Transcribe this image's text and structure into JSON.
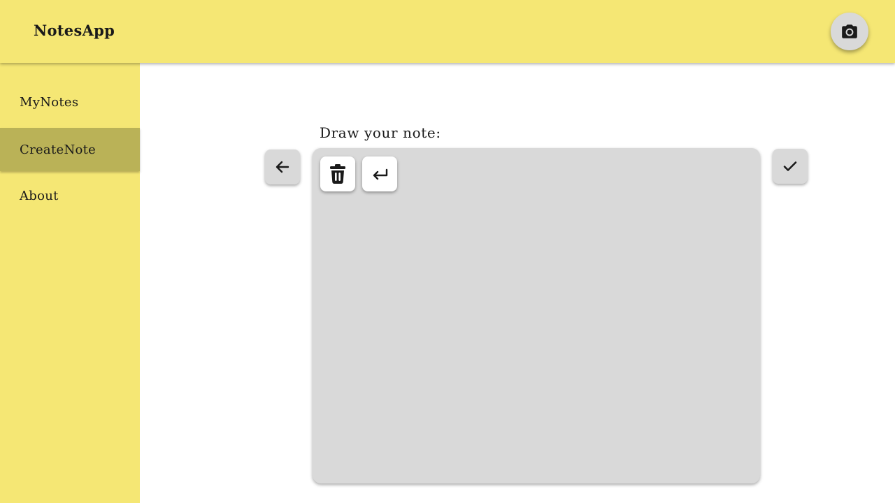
{
  "app": {
    "title": "NotesApp"
  },
  "header": {
    "camera_button": {
      "icon": "camera-icon"
    }
  },
  "sidebar": {
    "items": [
      {
        "label": "MyNotes",
        "active": false
      },
      {
        "label": "CreateNote",
        "active": true
      },
      {
        "label": "About",
        "active": false
      }
    ]
  },
  "main": {
    "prompt": "Draw your note:",
    "back_button": {
      "icon": "arrow-left-icon"
    },
    "confirm_button": {
      "icon": "check-icon"
    },
    "canvas_tools": [
      {
        "icon": "trash-icon"
      },
      {
        "icon": "undo-return-icon"
      }
    ]
  },
  "colors": {
    "accent_yellow": "#f5e774",
    "active_nav": "#bab257",
    "canvas_grey": "#d9d9d9",
    "button_grey": "#d9d9d9",
    "white": "#ffffff",
    "icon_dark": "#1a1a1a"
  }
}
